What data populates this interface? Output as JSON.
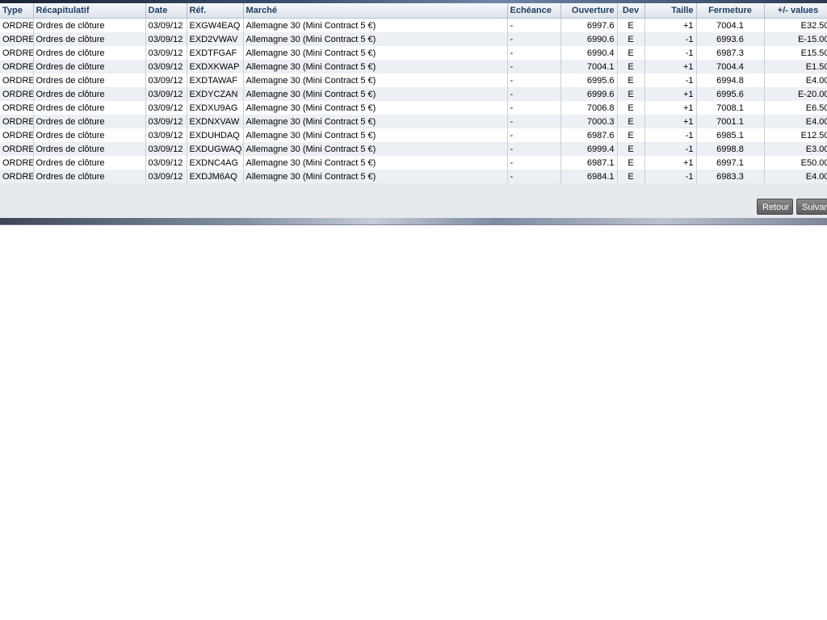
{
  "table": {
    "headers": {
      "type": "Type",
      "recap": "Récapitulatif",
      "date": "Date",
      "ref": "Réf.",
      "marche": "Marché",
      "echeance": "Echéance",
      "ouverture": "Ouverture",
      "dev": "Dev",
      "taille": "Taille",
      "fermeture": "Fermeture",
      "pl": "+/- values"
    },
    "rows": [
      {
        "type": "ORDRE",
        "recap": "Ordres de clôture",
        "date": "03/09/12",
        "ref": "EXGW4EAQ",
        "marche": "Allemagne 30 (Mini Contract 5 €)",
        "echeance": "-",
        "ouverture": "6997.6",
        "dev": "E",
        "taille": "+1",
        "fermeture": "7004.1",
        "pl": "E32.50"
      },
      {
        "type": "ORDRE",
        "recap": "Ordres de clôture",
        "date": "03/09/12",
        "ref": "EXD2VWAV",
        "marche": "Allemagne 30 (Mini Contract 5 €)",
        "echeance": "-",
        "ouverture": "6990.6",
        "dev": "E",
        "taille": "-1",
        "fermeture": "6993.6",
        "pl": "E-15.00"
      },
      {
        "type": "ORDRE",
        "recap": "Ordres de clôture",
        "date": "03/09/12",
        "ref": "EXDTFGAF",
        "marche": "Allemagne 30 (Mini Contract 5 €)",
        "echeance": "-",
        "ouverture": "6990.4",
        "dev": "E",
        "taille": "-1",
        "fermeture": "6987.3",
        "pl": "E15.50"
      },
      {
        "type": "ORDRE",
        "recap": "Ordres de clôture",
        "date": "03/09/12",
        "ref": "EXDXKWAP",
        "marche": "Allemagne 30 (Mini Contract 5 €)",
        "echeance": "-",
        "ouverture": "7004.1",
        "dev": "E",
        "taille": "+1",
        "fermeture": "7004.4",
        "pl": "E1.50"
      },
      {
        "type": "ORDRE",
        "recap": "Ordres de clôture",
        "date": "03/09/12",
        "ref": "EXDTAWAF",
        "marche": "Allemagne 30 (Mini Contract 5 €)",
        "echeance": "-",
        "ouverture": "6995.6",
        "dev": "E",
        "taille": "-1",
        "fermeture": "6994.8",
        "pl": "E4.00"
      },
      {
        "type": "ORDRE",
        "recap": "Ordres de clôture",
        "date": "03/09/12",
        "ref": "EXDYCZAN",
        "marche": "Allemagne 30 (Mini Contract 5 €)",
        "echeance": "-",
        "ouverture": "6999.6",
        "dev": "E",
        "taille": "+1",
        "fermeture": "6995.6",
        "pl": "E-20.00"
      },
      {
        "type": "ORDRE",
        "recap": "Ordres de clôture",
        "date": "03/09/12",
        "ref": "EXDXU9AG",
        "marche": "Allemagne 30 (Mini Contract 5 €)",
        "echeance": "-",
        "ouverture": "7006.8",
        "dev": "E",
        "taille": "+1",
        "fermeture": "7008.1",
        "pl": "E6.50"
      },
      {
        "type": "ORDRE",
        "recap": "Ordres de clôture",
        "date": "03/09/12",
        "ref": "EXDNXVAW",
        "marche": "Allemagne 30 (Mini Contract 5 €)",
        "echeance": "-",
        "ouverture": "7000.3",
        "dev": "E",
        "taille": "+1",
        "fermeture": "7001.1",
        "pl": "E4.00"
      },
      {
        "type": "ORDRE",
        "recap": "Ordres de clôture",
        "date": "03/09/12",
        "ref": "EXDUHDAQ",
        "marche": "Allemagne 30 (Mini Contract 5 €)",
        "echeance": "-",
        "ouverture": "6987.6",
        "dev": "E",
        "taille": "-1",
        "fermeture": "6985.1",
        "pl": "E12.50"
      },
      {
        "type": "ORDRE",
        "recap": "Ordres de clôture",
        "date": "03/09/12",
        "ref": "EXDUGWAQ",
        "marche": "Allemagne 30 (Mini Contract 5 €)",
        "echeance": "-",
        "ouverture": "6999.4",
        "dev": "E",
        "taille": "-1",
        "fermeture": "6998.8",
        "pl": "E3.00"
      },
      {
        "type": "ORDRE",
        "recap": "Ordres de clôture",
        "date": "03/09/12",
        "ref": "EXDNC4AG",
        "marche": "Allemagne 30 (Mini Contract 5 €)",
        "echeance": "-",
        "ouverture": "6987.1",
        "dev": "E",
        "taille": "+1",
        "fermeture": "6997.1",
        "pl": "E50.00"
      },
      {
        "type": "ORDRE",
        "recap": "Ordres de clôture",
        "date": "03/09/12",
        "ref": "EXDJM6AQ",
        "marche": "Allemagne 30 (Mini Contract 5 €)",
        "echeance": "-",
        "ouverture": "6984.1",
        "dev": "E",
        "taille": "-1",
        "fermeture": "6983.3",
        "pl": "E4.00"
      }
    ]
  },
  "buttons": {
    "back_label": "Retour",
    "next_label": "Suivant"
  }
}
